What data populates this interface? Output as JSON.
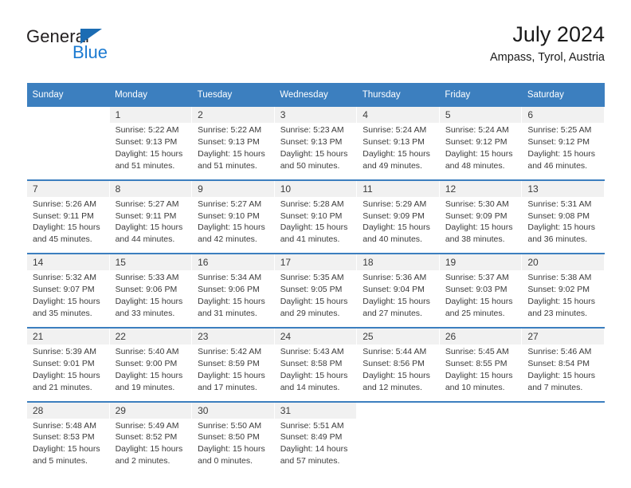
{
  "brand": {
    "name_part1": "General",
    "name_part2": "Blue",
    "accent_color": "#1b7ad1",
    "header_color": "#3c7fbf"
  },
  "header": {
    "title": "July 2024",
    "subtitle": "Ampass, Tyrol, Austria"
  },
  "weekday_headers": [
    "Sunday",
    "Monday",
    "Tuesday",
    "Wednesday",
    "Thursday",
    "Friday",
    "Saturday"
  ],
  "weeks": [
    [
      {
        "day": "",
        "lines": []
      },
      {
        "day": "1",
        "lines": [
          "Sunrise: 5:22 AM",
          "Sunset: 9:13 PM",
          "Daylight: 15 hours",
          "and 51 minutes."
        ]
      },
      {
        "day": "2",
        "lines": [
          "Sunrise: 5:22 AM",
          "Sunset: 9:13 PM",
          "Daylight: 15 hours",
          "and 51 minutes."
        ]
      },
      {
        "day": "3",
        "lines": [
          "Sunrise: 5:23 AM",
          "Sunset: 9:13 PM",
          "Daylight: 15 hours",
          "and 50 minutes."
        ]
      },
      {
        "day": "4",
        "lines": [
          "Sunrise: 5:24 AM",
          "Sunset: 9:13 PM",
          "Daylight: 15 hours",
          "and 49 minutes."
        ]
      },
      {
        "day": "5",
        "lines": [
          "Sunrise: 5:24 AM",
          "Sunset: 9:12 PM",
          "Daylight: 15 hours",
          "and 48 minutes."
        ]
      },
      {
        "day": "6",
        "lines": [
          "Sunrise: 5:25 AM",
          "Sunset: 9:12 PM",
          "Daylight: 15 hours",
          "and 46 minutes."
        ]
      }
    ],
    [
      {
        "day": "7",
        "lines": [
          "Sunrise: 5:26 AM",
          "Sunset: 9:11 PM",
          "Daylight: 15 hours",
          "and 45 minutes."
        ]
      },
      {
        "day": "8",
        "lines": [
          "Sunrise: 5:27 AM",
          "Sunset: 9:11 PM",
          "Daylight: 15 hours",
          "and 44 minutes."
        ]
      },
      {
        "day": "9",
        "lines": [
          "Sunrise: 5:27 AM",
          "Sunset: 9:10 PM",
          "Daylight: 15 hours",
          "and 42 minutes."
        ]
      },
      {
        "day": "10",
        "lines": [
          "Sunrise: 5:28 AM",
          "Sunset: 9:10 PM",
          "Daylight: 15 hours",
          "and 41 minutes."
        ]
      },
      {
        "day": "11",
        "lines": [
          "Sunrise: 5:29 AM",
          "Sunset: 9:09 PM",
          "Daylight: 15 hours",
          "and 40 minutes."
        ]
      },
      {
        "day": "12",
        "lines": [
          "Sunrise: 5:30 AM",
          "Sunset: 9:09 PM",
          "Daylight: 15 hours",
          "and 38 minutes."
        ]
      },
      {
        "day": "13",
        "lines": [
          "Sunrise: 5:31 AM",
          "Sunset: 9:08 PM",
          "Daylight: 15 hours",
          "and 36 minutes."
        ]
      }
    ],
    [
      {
        "day": "14",
        "lines": [
          "Sunrise: 5:32 AM",
          "Sunset: 9:07 PM",
          "Daylight: 15 hours",
          "and 35 minutes."
        ]
      },
      {
        "day": "15",
        "lines": [
          "Sunrise: 5:33 AM",
          "Sunset: 9:06 PM",
          "Daylight: 15 hours",
          "and 33 minutes."
        ]
      },
      {
        "day": "16",
        "lines": [
          "Sunrise: 5:34 AM",
          "Sunset: 9:06 PM",
          "Daylight: 15 hours",
          "and 31 minutes."
        ]
      },
      {
        "day": "17",
        "lines": [
          "Sunrise: 5:35 AM",
          "Sunset: 9:05 PM",
          "Daylight: 15 hours",
          "and 29 minutes."
        ]
      },
      {
        "day": "18",
        "lines": [
          "Sunrise: 5:36 AM",
          "Sunset: 9:04 PM",
          "Daylight: 15 hours",
          "and 27 minutes."
        ]
      },
      {
        "day": "19",
        "lines": [
          "Sunrise: 5:37 AM",
          "Sunset: 9:03 PM",
          "Daylight: 15 hours",
          "and 25 minutes."
        ]
      },
      {
        "day": "20",
        "lines": [
          "Sunrise: 5:38 AM",
          "Sunset: 9:02 PM",
          "Daylight: 15 hours",
          "and 23 minutes."
        ]
      }
    ],
    [
      {
        "day": "21",
        "lines": [
          "Sunrise: 5:39 AM",
          "Sunset: 9:01 PM",
          "Daylight: 15 hours",
          "and 21 minutes."
        ]
      },
      {
        "day": "22",
        "lines": [
          "Sunrise: 5:40 AM",
          "Sunset: 9:00 PM",
          "Daylight: 15 hours",
          "and 19 minutes."
        ]
      },
      {
        "day": "23",
        "lines": [
          "Sunrise: 5:42 AM",
          "Sunset: 8:59 PM",
          "Daylight: 15 hours",
          "and 17 minutes."
        ]
      },
      {
        "day": "24",
        "lines": [
          "Sunrise: 5:43 AM",
          "Sunset: 8:58 PM",
          "Daylight: 15 hours",
          "and 14 minutes."
        ]
      },
      {
        "day": "25",
        "lines": [
          "Sunrise: 5:44 AM",
          "Sunset: 8:56 PM",
          "Daylight: 15 hours",
          "and 12 minutes."
        ]
      },
      {
        "day": "26",
        "lines": [
          "Sunrise: 5:45 AM",
          "Sunset: 8:55 PM",
          "Daylight: 15 hours",
          "and 10 minutes."
        ]
      },
      {
        "day": "27",
        "lines": [
          "Sunrise: 5:46 AM",
          "Sunset: 8:54 PM",
          "Daylight: 15 hours",
          "and 7 minutes."
        ]
      }
    ],
    [
      {
        "day": "28",
        "lines": [
          "Sunrise: 5:48 AM",
          "Sunset: 8:53 PM",
          "Daylight: 15 hours",
          "and 5 minutes."
        ]
      },
      {
        "day": "29",
        "lines": [
          "Sunrise: 5:49 AM",
          "Sunset: 8:52 PM",
          "Daylight: 15 hours",
          "and 2 minutes."
        ]
      },
      {
        "day": "30",
        "lines": [
          "Sunrise: 5:50 AM",
          "Sunset: 8:50 PM",
          "Daylight: 15 hours",
          "and 0 minutes."
        ]
      },
      {
        "day": "31",
        "lines": [
          "Sunrise: 5:51 AM",
          "Sunset: 8:49 PM",
          "Daylight: 14 hours",
          "and 57 minutes."
        ]
      },
      {
        "day": "",
        "lines": []
      },
      {
        "day": "",
        "lines": []
      },
      {
        "day": "",
        "lines": []
      }
    ]
  ]
}
